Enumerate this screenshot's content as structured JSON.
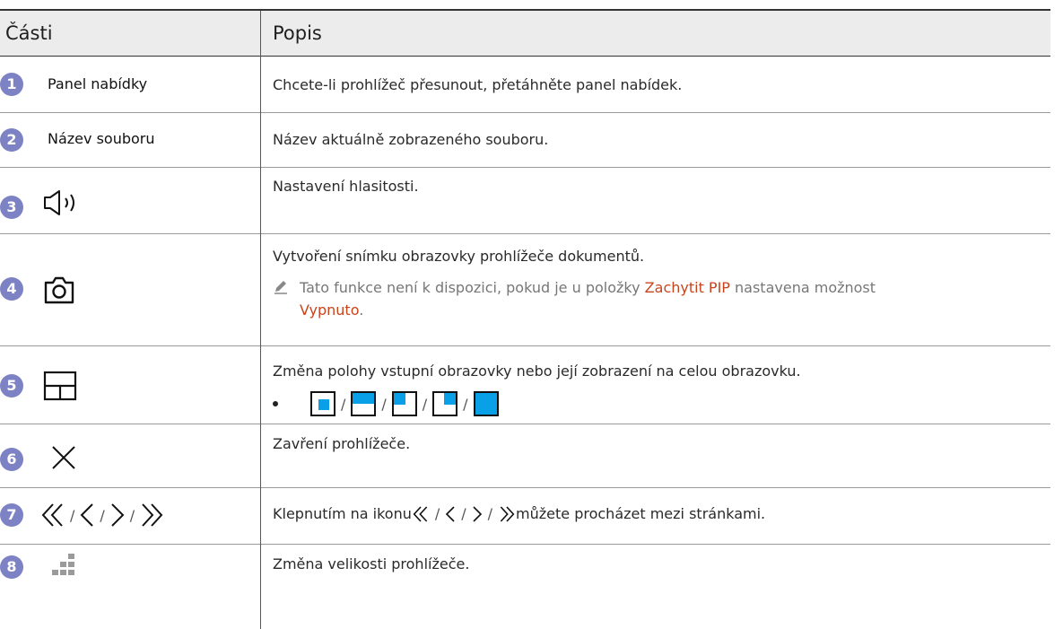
{
  "header": {
    "parts": "Části",
    "description": "Popis"
  },
  "rows": [
    {
      "num": "1",
      "part": "Panel nabídky",
      "desc": "Chcete-li prohlížeč přesunout, přetáhněte panel nabídek."
    },
    {
      "num": "2",
      "part": "Název souboru",
      "desc": "Název aktuálně zobrazeného souboru."
    },
    {
      "num": "3",
      "icon": "speaker-icon",
      "desc": "Nastavení hlasitosti."
    },
    {
      "num": "4",
      "icon": "camera-icon",
      "desc": "Vytvoření snímku obrazovky prohlížeče dokumentů.",
      "note_pre": "Tato funkce není k dispozici, pokud je u položky ",
      "note_hl1": "Zachytit PIP",
      "note_mid": " nastavena možnost",
      "note_hl2": "Vypnuto",
      "note_end": "."
    },
    {
      "num": "5",
      "icon": "layout-icon",
      "desc": "Změna polohy vstupní obrazovky nebo její zobrazení na celou obrazovku.",
      "separator": "/"
    },
    {
      "num": "6",
      "icon": "close-icon",
      "desc": "Zavření prohlížeče."
    },
    {
      "num": "7",
      "icon": "page-nav-icons",
      "desc_pre": "Klepnutím na ikonu ",
      "desc_post": " můžete procházet mezi stránkami.",
      "separator": "/"
    },
    {
      "num": "8",
      "icon": "resize-icon",
      "desc": "Změna velikosti prohlížeče."
    }
  ],
  "colors": {
    "badge": "#7c82c4",
    "highlight": "#c9441d",
    "accent_blue": "#0aa0e8"
  }
}
